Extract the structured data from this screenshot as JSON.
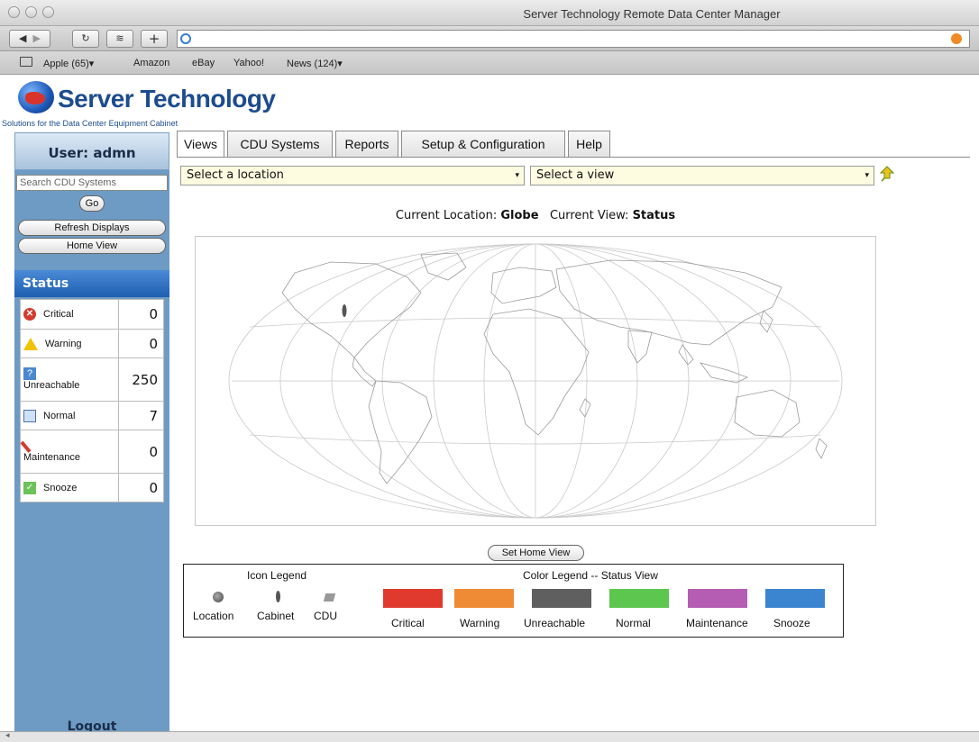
{
  "window": {
    "title": "Server Technology Remote Data Center Manager"
  },
  "toolbar": {
    "url": ""
  },
  "bookmarks": [
    "Apple (65)▾",
    "Amazon",
    "eBay",
    "Yahoo!",
    "News (124)▾"
  ],
  "logo": {
    "name": "Server Technology",
    "tagline": "Solutions for the Data Center Equipment Cabinet"
  },
  "sidebar": {
    "user": "User: admn",
    "search_placeholder": "Search CDU Systems",
    "go": "Go",
    "refresh": "Refresh Displays",
    "home_view": "Home View",
    "status_title": "Status",
    "statuses": [
      {
        "label": "Critical",
        "value": "0"
      },
      {
        "label": "Warning",
        "value": "0"
      },
      {
        "label": "Unreachable",
        "value": "250"
      },
      {
        "label": "Normal",
        "value": "7"
      },
      {
        "label": "Maintenance",
        "value": "0"
      },
      {
        "label": "Snooze",
        "value": "0"
      }
    ],
    "logout": "Logout"
  },
  "tabs": [
    "Views",
    "CDU Systems",
    "Reports",
    "Setup & Configuration",
    "Help"
  ],
  "selects": {
    "location": "Select a location",
    "view": "Select a view"
  },
  "current": {
    "location_label": "Current Location:",
    "location": "Globe",
    "view_label": "Current View:",
    "view": "Status"
  },
  "set_home_view": "Set Home View",
  "legend": {
    "icon_title": "Icon Legend",
    "icons": [
      "Location",
      "Cabinet",
      "CDU"
    ],
    "color_title": "Color Legend -- Status View",
    "colors": [
      {
        "label": "Critical",
        "color": "#e03a2e"
      },
      {
        "label": "Warning",
        "color": "#ee8b34"
      },
      {
        "label": "Unreachable",
        "color": "#5f5f5f"
      },
      {
        "label": "Normal",
        "color": "#5cc64f"
      },
      {
        "label": "Maintenance",
        "color": "#b45db2"
      },
      {
        "label": "Snooze",
        "color": "#3b84d0"
      }
    ]
  }
}
